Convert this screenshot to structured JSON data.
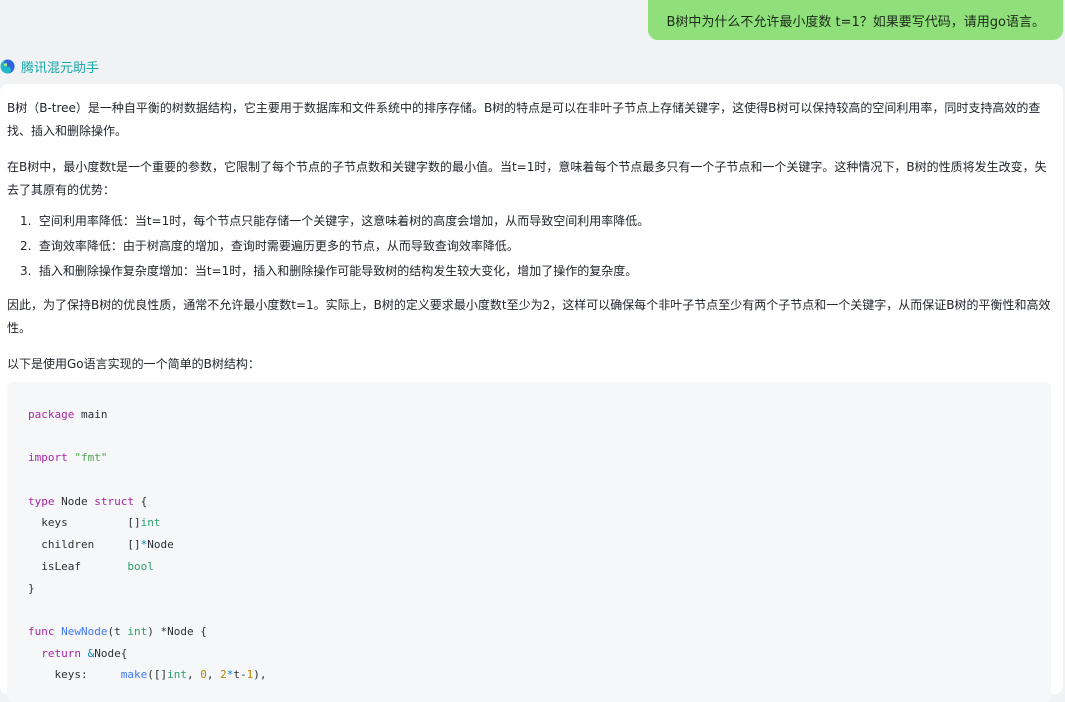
{
  "user_message": "B树中为什么不允许最小度数 t=1？如果要写代码，请用go语言。",
  "assistant": {
    "name": "腾讯混元助手",
    "paragraph_1": "B树（B-tree）是一种自平衡的树数据结构，它主要用于数据库和文件系统中的排序存储。B树的特点是可以在非叶子节点上存储关键字，这使得B树可以保持较高的空间利用率，同时支持高效的查找、插入和删除操作。",
    "paragraph_2": "在B树中，最小度数t是一个重要的参数，它限制了每个节点的子节点数和关键字数的最小值。当t=1时，意味着每个节点最多只有一个子节点和一个关键字。这种情况下，B树的性质将发生改变，失去了其原有的优势：",
    "list": [
      {
        "num": "1.",
        "text": "空间利用率降低：当t=1时，每个节点只能存储一个关键字，这意味着树的高度会增加，从而导致空间利用率降低。"
      },
      {
        "num": "2.",
        "text": "查询效率降低：由于树高度的增加，查询时需要遍历更多的节点，从而导致查询效率降低。"
      },
      {
        "num": "3.",
        "text": "插入和删除操作复杂度增加：当t=1时，插入和删除操作可能导致树的结构发生较大变化，增加了操作的复杂度。"
      }
    ],
    "paragraph_3": "因此，为了保持B树的优良性质，通常不允许最小度数t=1。实际上，B树的定义要求最小度数t至少为2，这样可以确保每个非叶子节点至少有两个子节点和一个关键字，从而保证B树的平衡性和高效性。",
    "paragraph_4": "以下是使用Go语言实现的一个简单的B树结构：",
    "code": {
      "language": "go",
      "tokens": {
        "package_kw": "package",
        "package_name": " main",
        "import_kw": "import",
        "import_str": " \"fmt\"",
        "type_kw": "type",
        "type_name": " Node ",
        "struct_kw": "struct",
        "struct_open": " {",
        "f1_name": "  keys         ",
        "f1_br": "[]",
        "f1_type": "int",
        "f2_name": "  children     ",
        "f2_br": "[]",
        "f2_ptr": "*",
        "f2_type": "Node",
        "f3_name": "  isLeaf       ",
        "f3_type": "bool",
        "close_brace": "}",
        "func_kw": "func",
        "func_name": " NewNode",
        "func_open": "(t ",
        "func_int": "int",
        "func_rest": ") *Node {",
        "return_kw": "  return",
        "return_amp": " &",
        "return_rest": "Node{",
        "keys_label": "    keys:     ",
        "make_fn": "make",
        "make_open": "([]",
        "make_int": "int",
        "make_comma": ", ",
        "zero": "0",
        "comma2": ", ",
        "two": "2",
        "star": "*",
        "t_minus": "t-",
        "one": "1",
        "make_close": "),"
      }
    }
  },
  "colors": {
    "page_bg": "#f1f2f4",
    "user_bubble": "#8fe07a",
    "assistant_name": "#16a8a8",
    "code_bg": "#f6f7f9",
    "keyword": "#a626a4",
    "string": "#50a14f",
    "type": "#2a9d6a",
    "function": "#4078f2",
    "number": "#b58300"
  },
  "icons": {
    "avatar": "hunyuan-logo-icon"
  }
}
